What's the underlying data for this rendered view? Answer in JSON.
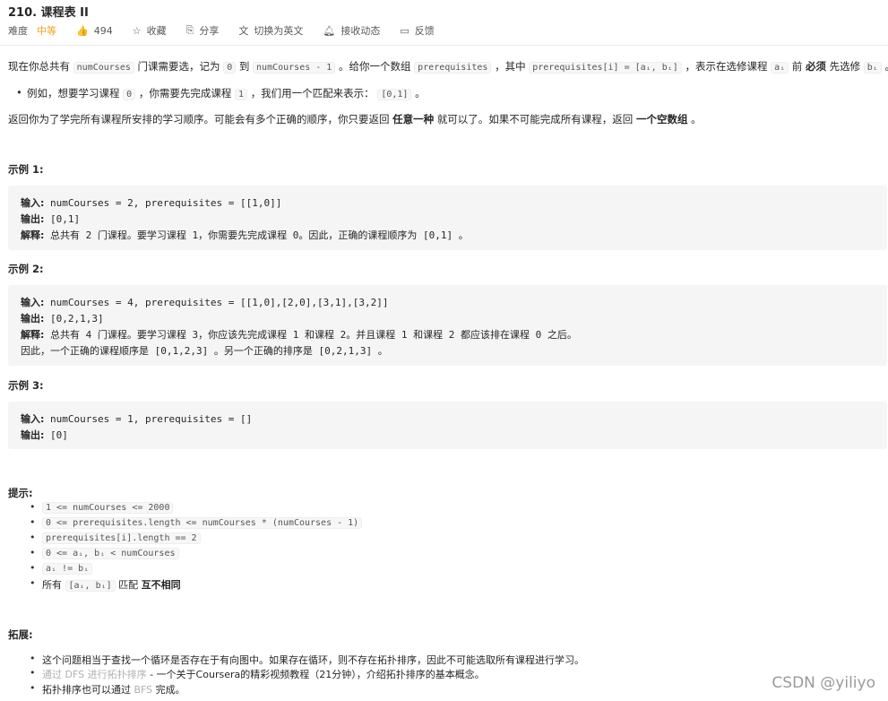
{
  "problem": {
    "title": "210. 课程表 II",
    "difficulty_label": "难度",
    "difficulty": "中等",
    "likes": "494",
    "actions": [
      "收藏",
      "分享",
      "切换为英文",
      "接收动态",
      "反馈"
    ]
  },
  "description": {
    "p1": {
      "t1": "现在你总共有",
      "c1": "numCourses",
      "t2": "门课需要选，记为",
      "c2": "0",
      "t3": "到",
      "c3": "numCourses - 1",
      "t4": "。给你一个数组",
      "c4": "prerequisites",
      "t5": "，其中",
      "c5": "prerequisites[i] = [aᵢ, bᵢ]",
      "t6": "，表示在选修课程",
      "c6": "aᵢ",
      "t7": "前",
      "b1": "必须",
      "t8": "先选修",
      "c7": "bᵢ",
      "t9": "。"
    },
    "bullet": {
      "t1": "例如，想要学习课程",
      "c1": "0",
      "t2": "，你需要先完成课程",
      "c2": "1",
      "t3": "，我们用一个匹配来表示：",
      "c3": "[0,1]",
      "t4": "。"
    },
    "p2": {
      "t1": "返回你为了学完所有课程所安排的学习顺序。可能会有多个正确的顺序，你只要返回",
      "b1": "任意一种",
      "t2": "就可以了。如果不可能完成所有课程，返回",
      "b2": "一个空数组",
      "t3": "。"
    }
  },
  "examples": [
    {
      "heading": "示例 1:",
      "input_label": "输入:",
      "input": "numCourses = 2, prerequisites = [[1,0]]",
      "output_label": "输出:",
      "output": "[0,1]",
      "explain_label": "解释:",
      "explain": "总共有 2 门课程。要学习课程 1，你需要先完成课程 0。因此，正确的课程顺序为 [0,1] 。"
    },
    {
      "heading": "示例 2:",
      "input_label": "输入:",
      "input": "numCourses = 4, prerequisites = [[1,0],[2,0],[3,1],[3,2]]",
      "output_label": "输出:",
      "output": "[0,2,1,3]",
      "explain_label": "解释:",
      "explain": "总共有 4 门课程。要学习课程 3，你应该先完成课程 1 和课程 2。并且课程 1 和课程 2 都应该排在课程 0 之后。",
      "explain2": "因此，一个正确的课程顺序是 [0,1,2,3] 。另一个正确的排序是 [0,2,1,3] 。"
    },
    {
      "heading": "示例 3:",
      "input_label": "输入:",
      "input": "numCourses = 1, prerequisites = []",
      "output_label": "输出:",
      "output": "[0]"
    }
  ],
  "hints": {
    "heading": "提示:",
    "items": [
      "1 <= numCourses <= 2000",
      "0 <= prerequisites.length <= numCourses * (numCourses - 1)",
      "prerequisites[i].length == 2",
      "0 <= aᵢ, bᵢ < numCourses",
      "aᵢ != bᵢ"
    ],
    "last_prefix": "所有",
    "last_code": "[aᵢ, bᵢ]",
    "last_mid": "匹配",
    "last_bold": "互不相同"
  },
  "extension": {
    "heading": "拓展:",
    "item1": "这个问题相当于查找一个循环是否存在于有向图中。如果存在循环，则不存在拓扑排序，因此不可能选取所有课程进行学习。",
    "item2_link": "通过 DFS 进行拓扑排序",
    "item2_rest": " - 一个关于Coursera的精彩视频教程（21分钟），介绍拓扑排序的基本概念。",
    "item3_pre": "拓扑排序也可以通过",
    "item3_link": "BFS",
    "item3_post": "完成。"
  },
  "watermark": "CSDN @yiliyo"
}
